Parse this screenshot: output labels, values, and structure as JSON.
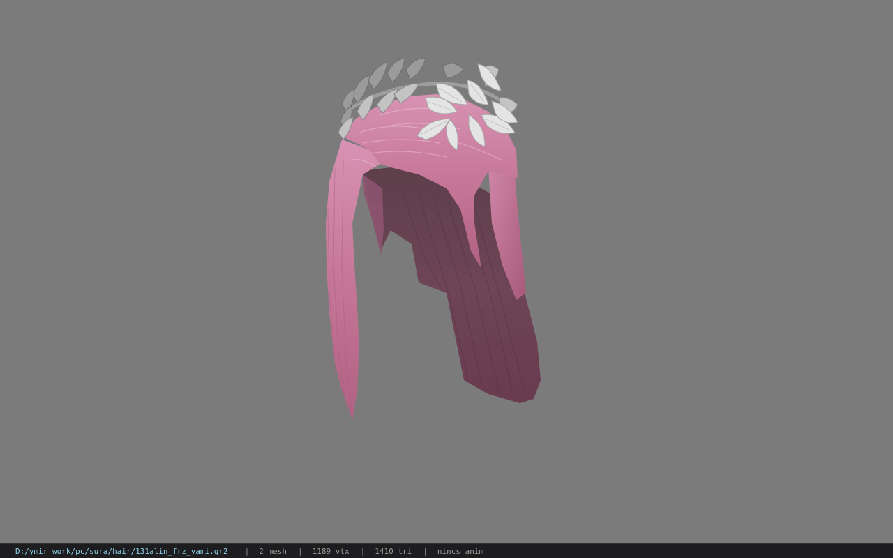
{
  "viewer": {
    "background_color": "#7b7b7b",
    "model_icon": "hair-model-with-leaf-crown",
    "hair_color": "#c97a9c",
    "crown_color": "#d8d8d8"
  },
  "status_bar": {
    "file_path": "D:/ymir work/pc/sura/hair/131alin_frz_yami.gr2",
    "separator": "|",
    "mesh_count": "2 mesh",
    "vertex_count": "1189 vtx",
    "triangle_count": "1410 tri",
    "anim_status": "nincs anim"
  }
}
